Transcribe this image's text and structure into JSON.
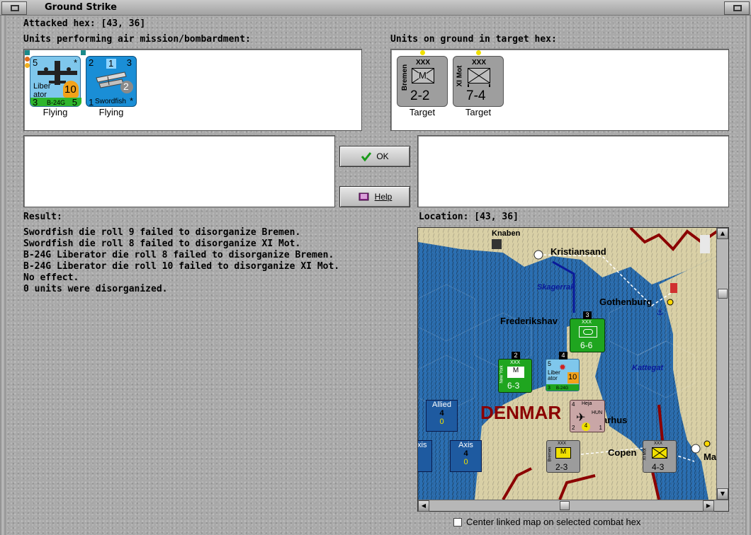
{
  "window": {
    "title": "Ground Strike"
  },
  "attacked_hex": {
    "label": "Attacked hex:",
    "value": "[43, 36]"
  },
  "air_units": {
    "heading": "Units performing air mission/bombardment:",
    "units": [
      {
        "name_line1": "Liber",
        "name_line2": "ator",
        "type": "B-24G",
        "top_left": "5",
        "bottom_left": "3",
        "bottom_right": "5",
        "strength": "10",
        "star": "*",
        "status": "Flying"
      },
      {
        "name": "Swordfish",
        "top_left": "2",
        "top_mid": "1",
        "top_right": "3",
        "bottom_left": "1",
        "circle": "2",
        "star": "*",
        "status": "Flying"
      }
    ]
  },
  "ground_units": {
    "heading": "Units on ground in target hex:",
    "units": [
      {
        "size": "XXX",
        "name": "Bremen",
        "symbol": "M",
        "strength": "2-2",
        "status": "Target"
      },
      {
        "size": "XXX",
        "name": "XI Mot",
        "strength": "7-4",
        "status": "Target"
      }
    ]
  },
  "buttons": {
    "ok": "OK",
    "help": "Help"
  },
  "result": {
    "label": "Result:",
    "lines": [
      "Swordfish die roll 9 failed to disorganize Bremen.",
      "Swordfish die roll 8 failed to disorganize XI Mot.",
      "B-24G Liberator die roll 8 failed to disorganize Bremen.",
      "B-24G Liberator die roll 10 failed to disorganize XI Mot.",
      "No effect.",
      "0 units were disorganized."
    ]
  },
  "location": {
    "label": "Location:",
    "value": "[43, 36]"
  },
  "map": {
    "places": {
      "knaben": "Knaben",
      "kristiansand": "Kristiansand",
      "skagerrak": "Skagerrak",
      "gothenburg": "Gothenburg",
      "frederikshavn": "Frederikshav",
      "kattegat": "Kattegat",
      "denmark": "DENMAR",
      "aarhus": "arhus",
      "copenhagen": "Copen",
      "malmo": "Ma"
    },
    "allied_box": {
      "label": "Allied",
      "value": "4",
      "sub": "0"
    },
    "axis_box": {
      "label": "Axis",
      "value": "4",
      "sub": "0"
    },
    "axis_box_partial": {
      "label": "xis"
    },
    "counters": {
      "norway_corps": {
        "stack": "3",
        "size": "XXX",
        "strength": "6-6"
      },
      "new_york": {
        "stack": "2",
        "size": "XXX",
        "name": "New York",
        "symbol": "M",
        "strength": "6-3"
      },
      "liberator": {
        "stack": "4",
        "top": "5",
        "name": "Liber",
        "name2": "ator",
        "strength": "10",
        "bottom": "3",
        "type": "B-24G"
      },
      "heja": {
        "name": "Heja",
        "nation": "HUN",
        "top_left": "4",
        "bottom_left": "2",
        "circle": "4",
        "bottom_right": "1"
      },
      "bremen": {
        "size": "XXX",
        "name": "Bremen",
        "symbol": "M",
        "strength": "2-3"
      },
      "xi_mot": {
        "size": "XXX",
        "name": "XI Mot",
        "strength": "4-3"
      }
    }
  },
  "center_checkbox": {
    "label": "Center linked map on selected combat hex",
    "checked": false
  },
  "colors": {
    "sea": "#2a6db0",
    "land": "#d9d0a6",
    "allied_green": "#1fa51f",
    "air_blue": "#0a8ad8",
    "axis_gray": "#9c9c9c",
    "border_red": "#8b0000"
  }
}
